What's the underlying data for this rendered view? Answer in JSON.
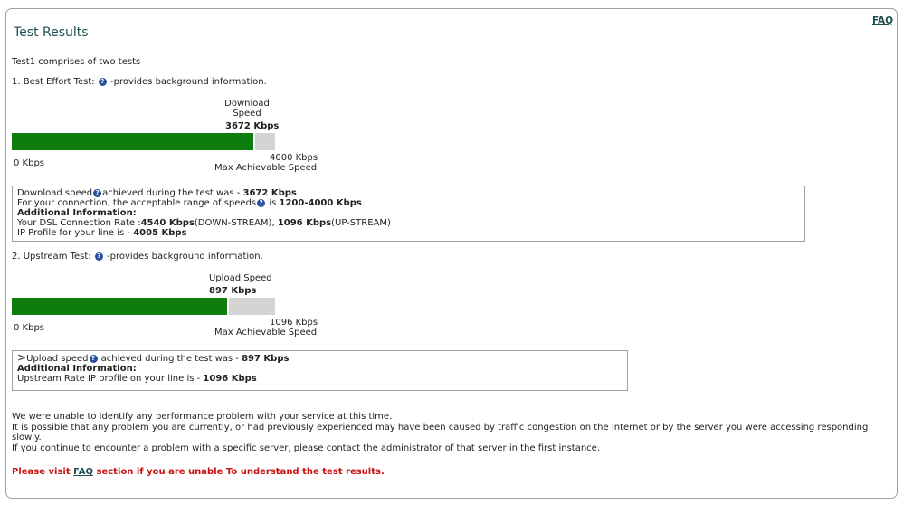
{
  "header": {
    "title": "Test Results",
    "faq_link": "FAQ"
  },
  "intro": "Test1 comprises of two tests",
  "help_icon_glyph": "?",
  "test1": {
    "label_prefix": "1. Best Effort Test:",
    "label_suffix": "-provides background information.",
    "speed_label_line1": "Download",
    "speed_label_line2": "Speed",
    "speed_value": "3672 Kbps",
    "fraction": 0.918,
    "min_label": "0 Kbps",
    "max_label": "4000 Kbps",
    "max_caption": "Max Achievable Speed",
    "info": {
      "line1_pre": "Download speed",
      "line1_mid": "achieved during the test was - ",
      "line1_val": "3672 Kbps",
      "line2_pre": "For your connection, the acceptable range of speeds",
      "line2_mid": " is ",
      "line2_val": "1200-4000 Kbps",
      "line2_end": ".",
      "additional_heading": "Additional Information:",
      "line4_pre": "Your DSL Connection Rate :",
      "line4_down_val": "4540 Kbps",
      "line4_down_label": "(DOWN-STREAM), ",
      "line4_up_val": "1096 Kbps",
      "line4_up_label": "(UP-STREAM)",
      "line5_pre": "IP Profile for your line is - ",
      "line5_val": "4005 Kbps"
    }
  },
  "test2": {
    "label_prefix": "2. Upstream Test:",
    "label_suffix": "-provides background information.",
    "speed_label": "Upload Speed",
    "speed_value": "897 Kbps",
    "fraction": 0.818,
    "min_label": "0 Kbps",
    "max_label": "1096 Kbps",
    "max_caption": "Max Achievable Speed",
    "info": {
      "arrow": ">",
      "line1_pre": "Upload speed",
      "line1_mid": " achieved during the test was - ",
      "line1_val": "897 Kbps",
      "additional_heading": "Additional Information:",
      "line3_pre": "Upstream Rate IP profile on your line is - ",
      "line3_val": "1096 Kbps"
    }
  },
  "footer": {
    "line1": "We were unable to identify any performance problem with your service at this time.",
    "line2": "It is possible that any problem you are currently, or had previously experienced may have been caused by traffic congestion on the Internet or by the server you were accessing responding",
    "line3": "slowly.",
    "line4": "If you continue to encounter a problem with a specific server, please contact the administrator of that server in the first instance.",
    "notice_pre": "Please visit ",
    "notice_link": "FAQ",
    "notice_post": " section if you are unable To understand the test results."
  },
  "colors": {
    "bar_fill": "#0d7d0d",
    "bar_track": "#d4d4d4",
    "title": "#1f4f4f",
    "notice": "#cc1111"
  }
}
